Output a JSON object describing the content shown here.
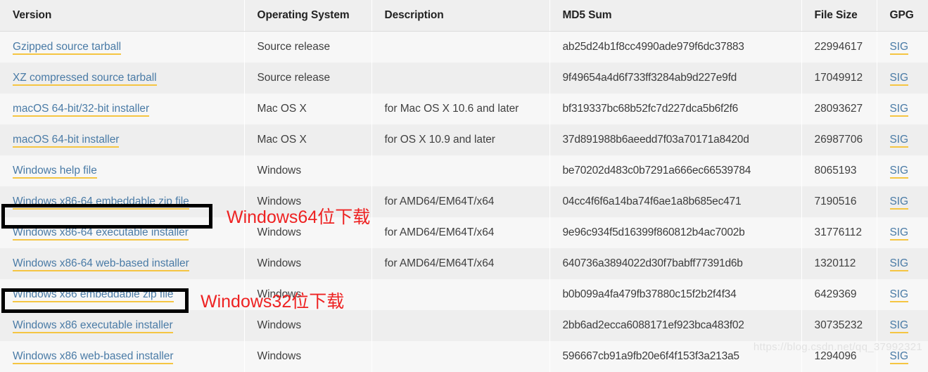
{
  "table": {
    "columns": [
      {
        "key": "version",
        "label": "Version"
      },
      {
        "key": "os",
        "label": "Operating System"
      },
      {
        "key": "description",
        "label": "Description"
      },
      {
        "key": "md5",
        "label": "MD5 Sum"
      },
      {
        "key": "size",
        "label": "File Size"
      },
      {
        "key": "gpg",
        "label": "GPG"
      }
    ],
    "rows": [
      {
        "version": "Gzipped source tarball",
        "os": "Source release",
        "description": "",
        "md5": "ab25d24b1f8cc4990ade979f6dc37883",
        "size": "22994617",
        "gpg": "SIG"
      },
      {
        "version": "XZ compressed source tarball",
        "os": "Source release",
        "description": "",
        "md5": "9f49654a4d6f733ff3284ab9d227e9fd",
        "size": "17049912",
        "gpg": "SIG"
      },
      {
        "version": "macOS 64-bit/32-bit installer",
        "os": "Mac OS X",
        "description": "for Mac OS X 10.6 and later",
        "md5": "bf319337bc68b52fc7d227dca5b6f2f6",
        "size": "28093627",
        "gpg": "SIG"
      },
      {
        "version": "macOS 64-bit installer",
        "os": "Mac OS X",
        "description": "for OS X 10.9 and later",
        "md5": "37d891988b6aeedd7f03a70171a8420d",
        "size": "26987706",
        "gpg": "SIG"
      },
      {
        "version": "Windows help file",
        "os": "Windows",
        "description": "",
        "md5": "be70202d483c0b7291a666ec66539784",
        "size": "8065193",
        "gpg": "SIG"
      },
      {
        "version": "Windows x86-64 embeddable zip file",
        "os": "Windows",
        "description": "for AMD64/EM64T/x64",
        "md5": "04cc4f6f6a14ba74f6ae1a8b685ec471",
        "size": "7190516",
        "gpg": "SIG"
      },
      {
        "version": "Windows x86-64 executable installer",
        "os": "Windows",
        "description": "for AMD64/EM64T/x64",
        "md5": "9e96c934f5d16399f860812b4ac7002b",
        "size": "31776112",
        "gpg": "SIG"
      },
      {
        "version": "Windows x86-64 web-based installer",
        "os": "Windows",
        "description": "for AMD64/EM64T/x64",
        "md5": "640736a3894022d30f7babff77391d6b",
        "size": "1320112",
        "gpg": "SIG"
      },
      {
        "version": "Windows x86 embeddable zip file",
        "os": "Windows",
        "description": "",
        "md5": "b0b099a4fa479fb37880c15f2b2f4f34",
        "size": "6429369",
        "gpg": "SIG"
      },
      {
        "version": "Windows x86 executable installer",
        "os": "Windows",
        "description": "",
        "md5": "2bb6ad2ecca6088171ef923bca483f02",
        "size": "30735232",
        "gpg": "SIG"
      },
      {
        "version": "Windows x86 web-based installer",
        "os": "Windows",
        "description": "",
        "md5": "596667cb91a9fb20e6f4f153f3a213a5",
        "size": "1294096",
        "gpg": "SIG"
      }
    ]
  },
  "annotations": {
    "highlight_color": "#000000",
    "text_color": "#ee2222",
    "items": [
      {
        "label": "Windows64位下载",
        "target_row": 6
      },
      {
        "label": "Windows32位下载",
        "target_row": 9
      }
    ]
  },
  "watermark": {
    "text": "https://blog.csdn.net/qq_37992321"
  }
}
